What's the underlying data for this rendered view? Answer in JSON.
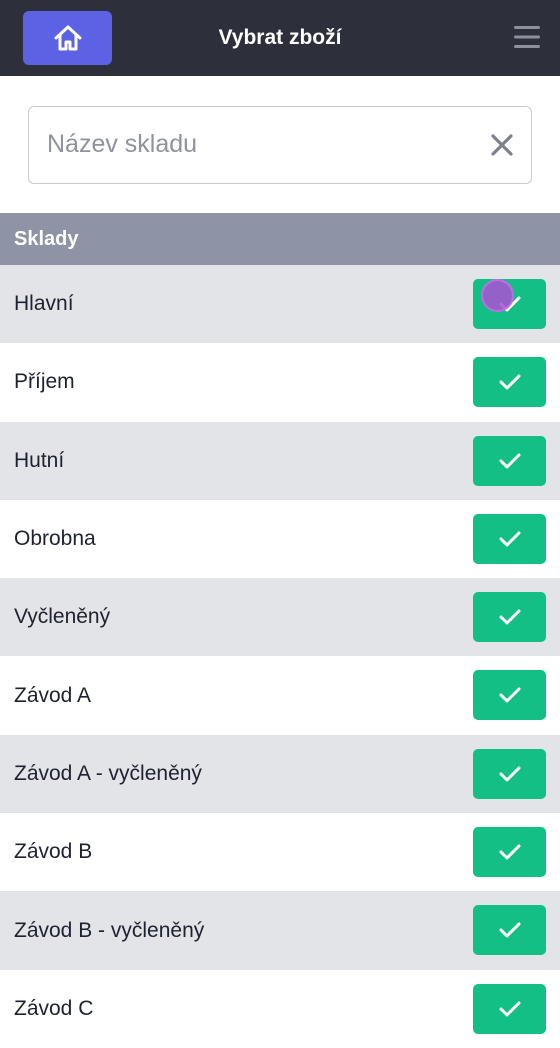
{
  "header": {
    "title": "Vybrat zboží",
    "home_icon": "home-icon",
    "menu_icon": "hamburger-menu-icon"
  },
  "search": {
    "placeholder": "Název skladu",
    "value": "",
    "clear_icon": "close-icon"
  },
  "section": {
    "title": "Sklady"
  },
  "warehouses": [
    {
      "label": "Hlavní"
    },
    {
      "label": "Příjem"
    },
    {
      "label": "Hutní"
    },
    {
      "label": "Obrobna"
    },
    {
      "label": "Vyčleněný"
    },
    {
      "label": "Závod A"
    },
    {
      "label": "Závod A - vyčleněný"
    },
    {
      "label": "Závod B"
    },
    {
      "label": "Závod B - vyčleněný"
    },
    {
      "label": "Závod C"
    }
  ],
  "colors": {
    "topbar": "#2d303b",
    "home_button": "#5b62e3",
    "section_header": "#8e93a5",
    "check_button": "#13bf84",
    "row_alt": "#e3e4e8"
  }
}
